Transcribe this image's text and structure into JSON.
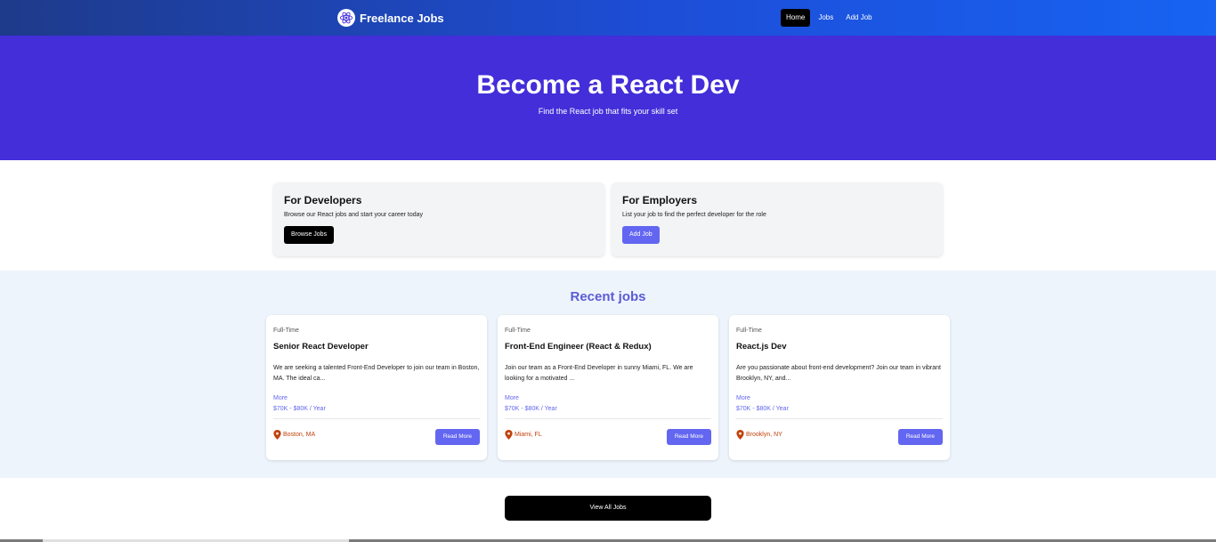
{
  "nav": {
    "brand": "Freelance Jobs",
    "links": [
      {
        "label": "Home",
        "active": true
      },
      {
        "label": "Jobs",
        "active": false
      },
      {
        "label": "Add Job",
        "active": false
      }
    ]
  },
  "hero": {
    "title": "Become a React Dev",
    "subtitle": "Find the React job that fits your skill set"
  },
  "promos": [
    {
      "title": "For Developers",
      "text": "Browse our React jobs and start your career today",
      "button": "Browse Jobs"
    },
    {
      "title": "For Employers",
      "text": "List your job to find the perfect developer for the role",
      "button": "Add Job"
    }
  ],
  "recent": {
    "heading": "Recent jobs",
    "jobs": [
      {
        "type": "Full-Time",
        "title": "Senior React Developer",
        "description": "We are seeking a talented Front-End Developer to join our team in Boston, MA. The ideal ca...",
        "more": "More",
        "salary": "$70K - $80K / Year",
        "location": "Boston, MA",
        "button": "Read More"
      },
      {
        "type": "Full-Time",
        "title": "Front-End Engineer (React & Redux)",
        "description": "Join our team as a Front-End Developer in sunny Miami, FL. We are looking for a motivated ...",
        "more": "More",
        "salary": "$70K - $80K / Year",
        "location": "Miami, FL",
        "button": "Read More"
      },
      {
        "type": "Full-Time",
        "title": "React.js Dev",
        "description": "Are you passionate about front-end development? Join our team in vibrant Brooklyn, NY, and...",
        "more": "More",
        "salary": "$70K - $80K / Year",
        "location": "Brooklyn, NY",
        "button": "Read More"
      }
    ]
  },
  "view_all": "View All Jobs",
  "colors": {
    "nav_start": "#1e3a8a",
    "nav_end": "#1763f2",
    "hero": "#432ed9",
    "accent": "#6366f1",
    "location": "#c2410c"
  }
}
